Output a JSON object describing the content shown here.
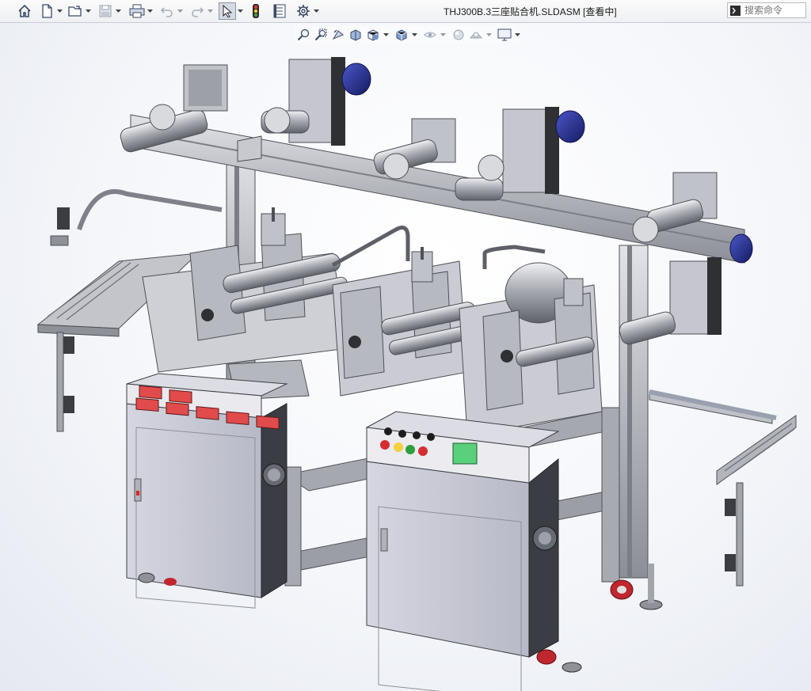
{
  "window": {
    "title": "THJ300B.3三座贴合机.SLDASM [查看中]"
  },
  "search": {
    "placeholder": "搜索命令"
  },
  "toolbar": {
    "icons": [
      "home-icon",
      "new-document-icon",
      "open-folder-icon",
      "save-icon",
      "print-icon",
      "undo-icon",
      "redo-icon",
      "select-arrow-icon",
      "traffic-light-icon",
      "file-properties-icon",
      "gear-icon"
    ]
  },
  "heads_up_toolbar": {
    "icons": [
      "zoom-to-fit-icon",
      "zoom-area-icon",
      "previous-view-icon",
      "section-view-icon",
      "view-orientation-icon",
      "display-style-icon",
      "hide-show-icon",
      "edit-appearance-icon",
      "apply-scene-icon",
      "view-settings-icon"
    ]
  },
  "colors": {
    "frame": "#b9bbc2",
    "frame_dark": "#7e8189",
    "motor_blue": "#1f2a8a",
    "cabinet": "#c9cad6",
    "red_wheel": "#c0262e",
    "panel_red": "#e24b4b"
  }
}
